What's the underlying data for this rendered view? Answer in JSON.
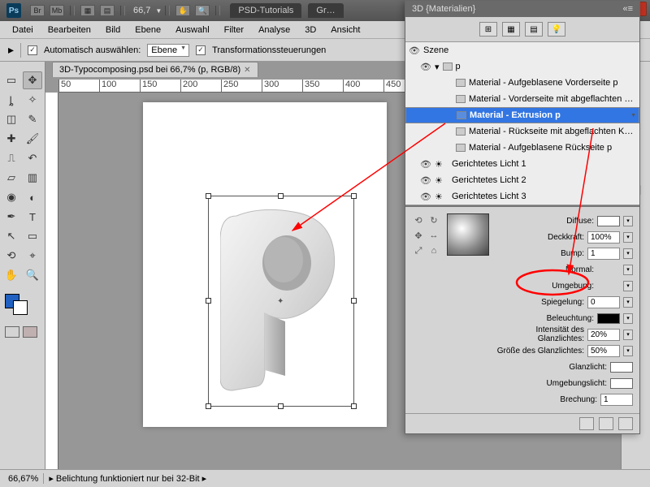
{
  "app": {
    "zoom_label": "66,7"
  },
  "title_tabs": {
    "t1": "PSD-Tutorials",
    "t2": "Gr…"
  },
  "menu": {
    "m0": "Datei",
    "m1": "Bearbeiten",
    "m2": "Bild",
    "m3": "Ebene",
    "m4": "Auswahl",
    "m5": "Filter",
    "m6": "Analyse",
    "m7": "3D",
    "m8": "Ansicht"
  },
  "options": {
    "auto_select": "Automatisch auswählen:",
    "layer_mode": "Ebene",
    "transform_ctrl": "Transformationssteuerungen"
  },
  "doc": {
    "tab": "3D-Typocomposing.psd bei 66,7% (p, RGB/8)"
  },
  "ruler": {
    "r0": "50",
    "r1": "100",
    "r2": "150",
    "r3": "200",
    "r4": "250",
    "r5": "300",
    "r6": "350",
    "r7": "400",
    "r8": "450"
  },
  "panel3d": {
    "title": "3D {Materialien}",
    "scene": {
      "root": "Szene",
      "p": "p",
      "items": [
        "Material - Aufgeblasene Vorderseite p",
        "Material - Vorderseite mit abgeflachten …",
        "Material - Extrusion p",
        "Material - Rückseite mit abgeflachten K…",
        "Material - Aufgeblasene Rückseite p",
        "Gerichtetes Licht 1",
        "Gerichtetes Licht 2",
        "Gerichtetes Licht 3"
      ]
    },
    "props": {
      "diffuse": "Diffuse:",
      "opacity_lbl": "Deckkraft:",
      "opacity_val": "100%",
      "bump_lbl": "Bump:",
      "bump_val": "1",
      "normal": "Normal:",
      "env": "Umgebung:",
      "refl_lbl": "Spiegelung:",
      "refl_val": "0",
      "illum": "Beleuchtung:",
      "gloss_int_lbl": "Intensität des Glanzlichtes:",
      "gloss_int_val": "20%",
      "gloss_size_lbl": "Größe des Glanzlichtes:",
      "gloss_size_val": "50%",
      "spec": "Glanzlicht:",
      "amb": "Umgebungslicht:",
      "refr_lbl": "Brechung:",
      "refr_val": "1"
    }
  },
  "status": {
    "zoom": "66,67%",
    "msg": "Belichtung funktioniert nur bei 32-Bit"
  }
}
